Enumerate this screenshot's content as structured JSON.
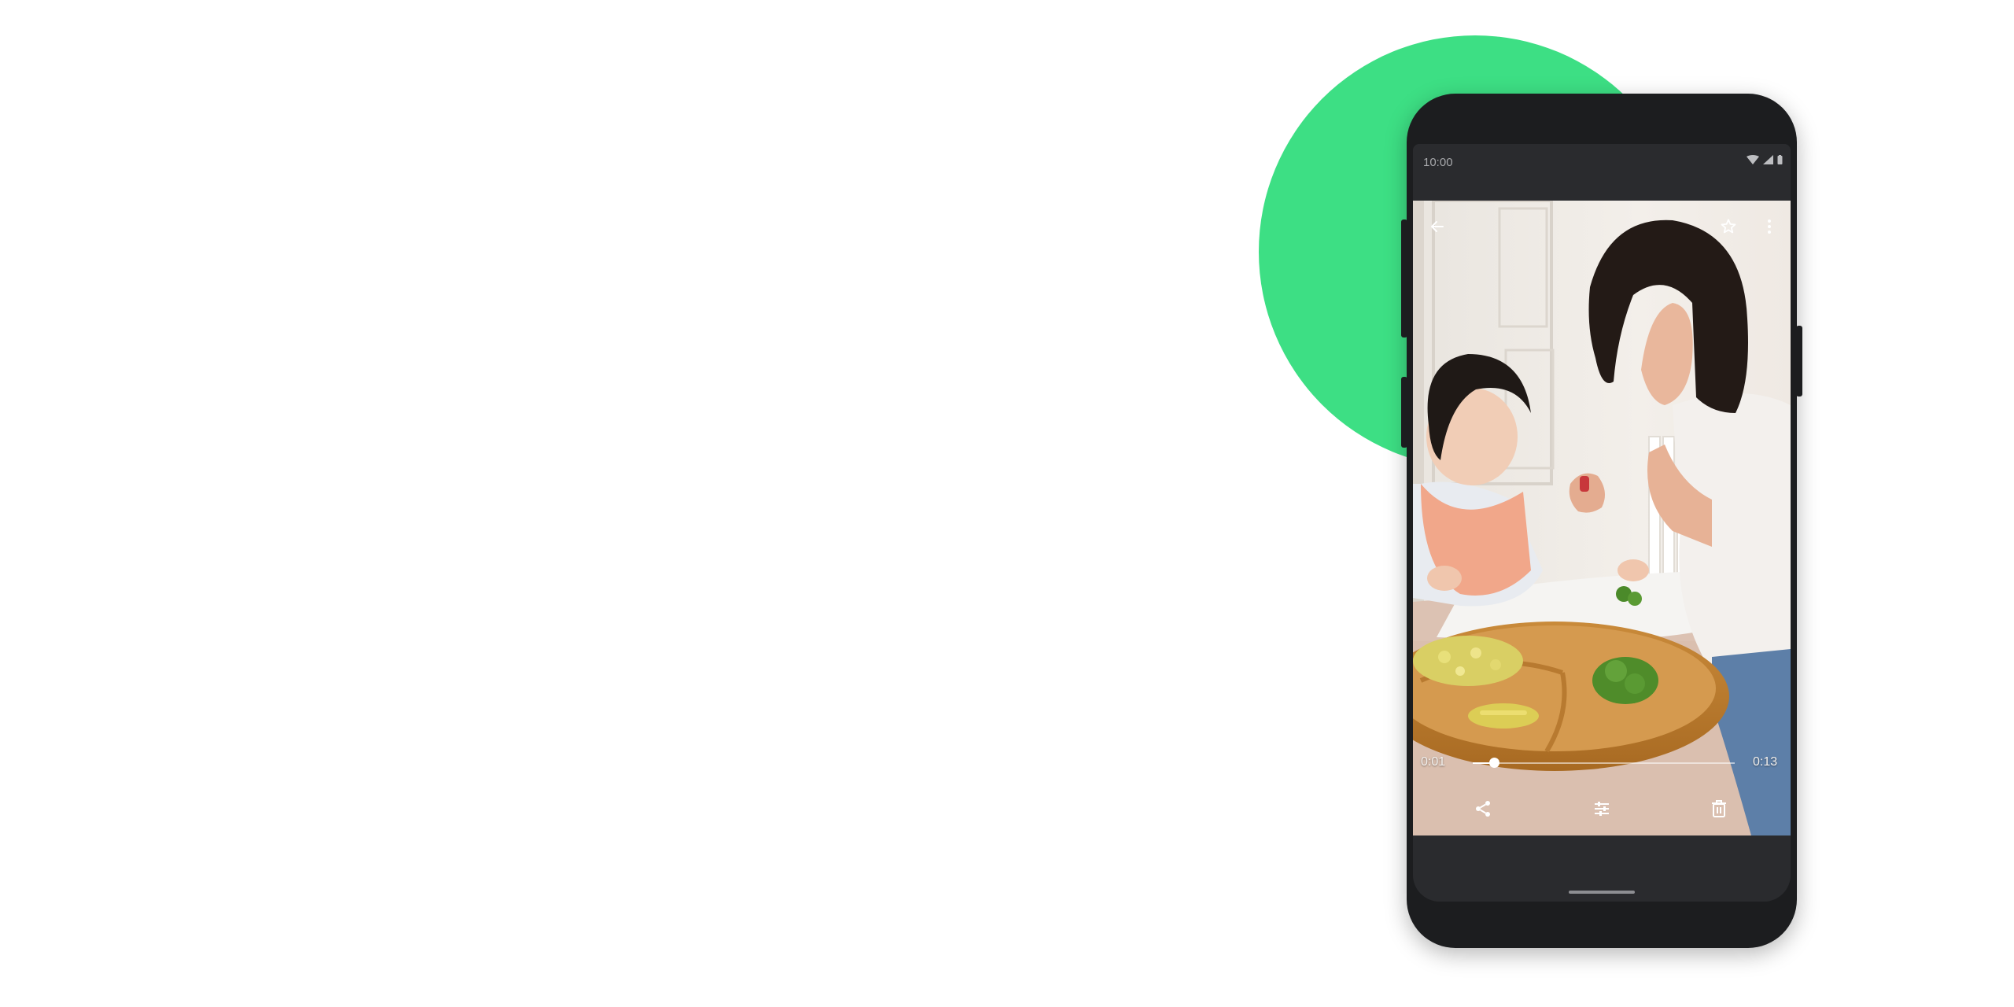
{
  "accent_color": "#3ddf84",
  "status_bar": {
    "time": "10:00",
    "icons": [
      "wifi-icon",
      "cellular-signal-icon",
      "battery-icon"
    ]
  },
  "viewer": {
    "top_actions": [
      "back-arrow-icon",
      "star-icon",
      "more-vert-icon"
    ],
    "video": {
      "current_time": "0:01",
      "duration": "0:13",
      "progress_fraction": 0.08
    },
    "bottom_actions": [
      "share-icon",
      "edit-sliders-icon",
      "delete-icon"
    ]
  }
}
